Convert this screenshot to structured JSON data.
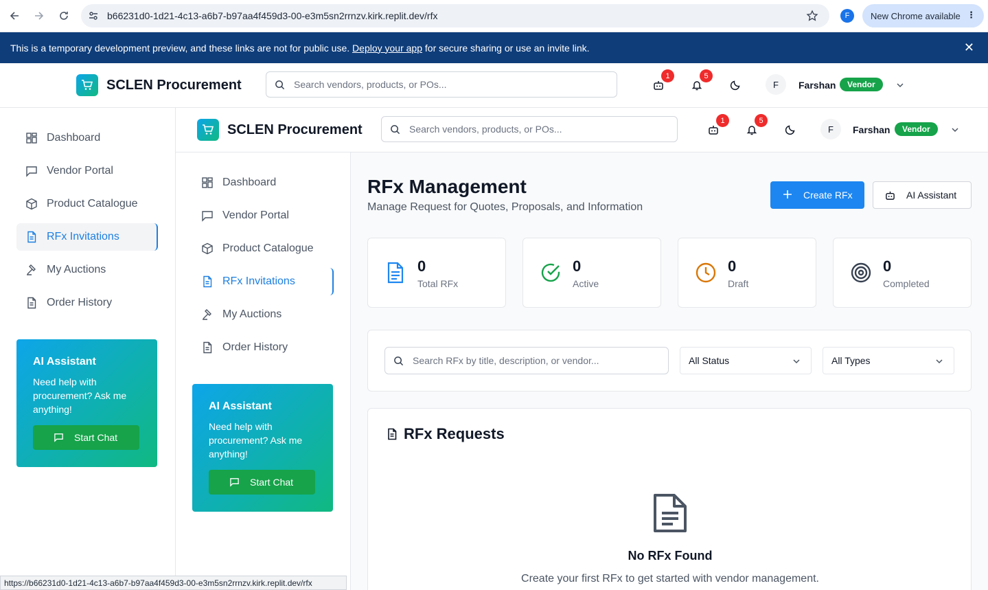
{
  "browser": {
    "url": "b66231d0-1d21-4c13-a6b7-b97aa4f459d3-00-e3m5sn2rrnzv.kirk.replit.dev/rfx",
    "profile_initial": "F",
    "update_label": "New Chrome available"
  },
  "banner": {
    "text_before": "This is a temporary development preview, and these links are not for public use. ",
    "link": "Deploy your app",
    "text_after": " for secure sharing or use an invite link."
  },
  "header": {
    "brand": "SCLEN Procurement",
    "search_placeholder": "Search vendors, products, or POs...",
    "bot_badge": "1",
    "notif_badge": "5",
    "user_initial": "F",
    "user_name": "Farshan",
    "role": "Vendor"
  },
  "sidebar": {
    "items": [
      {
        "label": "Dashboard",
        "icon": "dashboard-icon"
      },
      {
        "label": "Vendor Portal",
        "icon": "message-square-icon"
      },
      {
        "label": "Product Catalogue",
        "icon": "package-icon"
      },
      {
        "label": "RFx Invitations",
        "icon": "file-text-icon"
      },
      {
        "label": "My Auctions",
        "icon": "gavel-icon"
      },
      {
        "label": "Order History",
        "icon": "file-icon"
      }
    ],
    "ai": {
      "title": "AI Assistant",
      "desc": "Need help with procurement? Ask me anything!",
      "button": "Start Chat"
    }
  },
  "page": {
    "title": "RFx Management",
    "subtitle": "Manage Request for Quotes, Proposals, and Information",
    "create_button": "Create RFx",
    "ai_button": "AI Assistant",
    "stats": [
      {
        "value": "0",
        "label": "Total RFx",
        "color": "#1d86f0"
      },
      {
        "value": "0",
        "label": "Active",
        "color": "#16a34a"
      },
      {
        "value": "0",
        "label": "Draft",
        "color": "#d97706"
      },
      {
        "value": "0",
        "label": "Completed",
        "color": "#374151"
      }
    ],
    "filter_placeholder": "Search RFx by title, description, or vendor...",
    "status_select": "All Status",
    "type_select": "All Types",
    "requests_title": "RFx Requests",
    "empty_title": "No RFx Found",
    "empty_desc": "Create your first RFx to get started with vendor management."
  },
  "statusbar": {
    "link": "https://b66231d0-1d21-4c13-a6b7-b97aa4f459d3-00-e3m5sn2rrnzv.kirk.replit.dev/rfx"
  }
}
